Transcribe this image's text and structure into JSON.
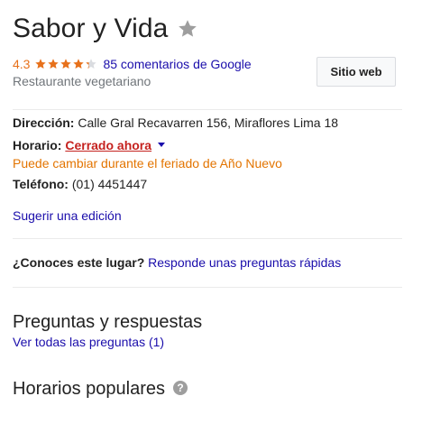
{
  "place": {
    "name": "Sabor y Vida",
    "rating": "4.3",
    "stars_filled_fraction": 0.86,
    "reviews_link": "85 comentarios de Google",
    "category": "Restaurante vegetariano",
    "website_button": "Sitio web"
  },
  "details": {
    "address_label": "Dirección:",
    "address_value": "Calle Gral Recavarren 156, Miraflores Lima 18",
    "hours_label": "Horario:",
    "hours_status": "Cerrado ahora",
    "hours_note": "Puede cambiar durante el feriado de Año Nuevo",
    "phone_label": "Teléfono:",
    "phone_value": "(01) 4451447",
    "suggest_edit": "Sugerir una edición"
  },
  "know_place": {
    "question": "¿Conoces este lugar?",
    "link": "Responde unas preguntas rápidas"
  },
  "qa": {
    "title": "Preguntas y respuestas",
    "link": "Ver todas las preguntas (1)"
  },
  "popular_times": {
    "title": "Horarios populares"
  },
  "colors": {
    "rating_orange": "#e7711b",
    "link_blue": "#1a0dab",
    "closed_red": "#c5221f",
    "note_orange": "#e37400"
  },
  "icons": {
    "save": "star-outline-icon",
    "rating": "star-icon",
    "hours_dropdown": "caret-down-icon",
    "help": "help-icon"
  }
}
